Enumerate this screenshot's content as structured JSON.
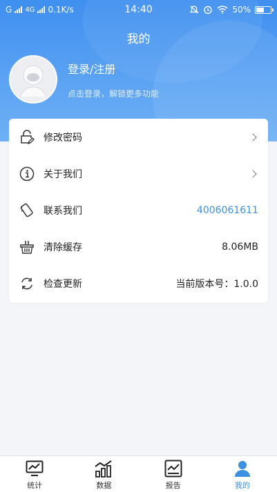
{
  "status_bar": {
    "left_1": "G",
    "left_2": "4G",
    "speed": "0.1K/s",
    "time": "14:40",
    "battery": "50%"
  },
  "header": {
    "title": "我的"
  },
  "profile": {
    "login_label": "登录/注册",
    "subtitle": "点击登录，解锁更多功能"
  },
  "menu": [
    {
      "label": "修改密码",
      "icon": "lock-edit-icon",
      "right": ""
    },
    {
      "label": "关于我们",
      "icon": "info-icon",
      "right": ""
    },
    {
      "label": "联系我们",
      "icon": "phone-icon",
      "right": "4006061611"
    },
    {
      "label": "清除缓存",
      "icon": "basket-icon",
      "right": "8.06MB"
    },
    {
      "label": "检查更新",
      "icon": "refresh-icon",
      "right": "当前版本号：1.0.0"
    }
  ],
  "tabs": [
    {
      "label": "统计",
      "icon": "monitor-chart-icon"
    },
    {
      "label": "数据",
      "icon": "bar-chart-icon"
    },
    {
      "label": "报告",
      "icon": "report-icon"
    },
    {
      "label": "我的",
      "icon": "person-icon"
    }
  ],
  "colors": {
    "accent": "#3d8fe0",
    "header": "#4b97f1"
  }
}
